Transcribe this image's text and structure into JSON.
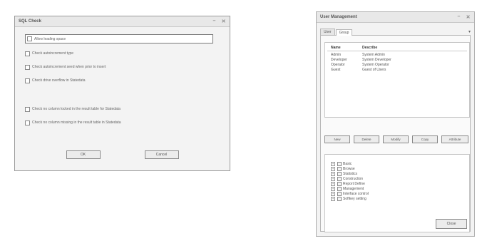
{
  "dialog1": {
    "title": "SQL Check",
    "options": [
      "Allow leading space",
      "Check autoincrement type",
      "Check autoincrement seed when prior to insert",
      "Check drive overflow in Statedata",
      "Check no column locked in the result table for Statedata",
      "Check no column missing in the result table in Statedata"
    ],
    "ok_label": "OK",
    "cancel_label": "Cancel"
  },
  "dialog2": {
    "title": "User Management",
    "tabs": [
      "User",
      "Group"
    ],
    "table": {
      "headers": [
        "Name",
        "Describe"
      ],
      "rows": [
        [
          "Admin",
          "System Admin"
        ],
        [
          "Developer",
          "System Developer"
        ],
        [
          "Operator",
          "System Operator"
        ],
        [
          "Guest",
          "Guest of Users"
        ]
      ]
    },
    "buttons": [
      "New",
      "Delete",
      "Modify",
      "Copy",
      "Attribute"
    ],
    "tree": [
      "Basic",
      "Browse",
      "Statistics",
      "Construction",
      "Report Define",
      "Management",
      "Interface control",
      "Softkey setting"
    ],
    "close_label": "Close"
  }
}
